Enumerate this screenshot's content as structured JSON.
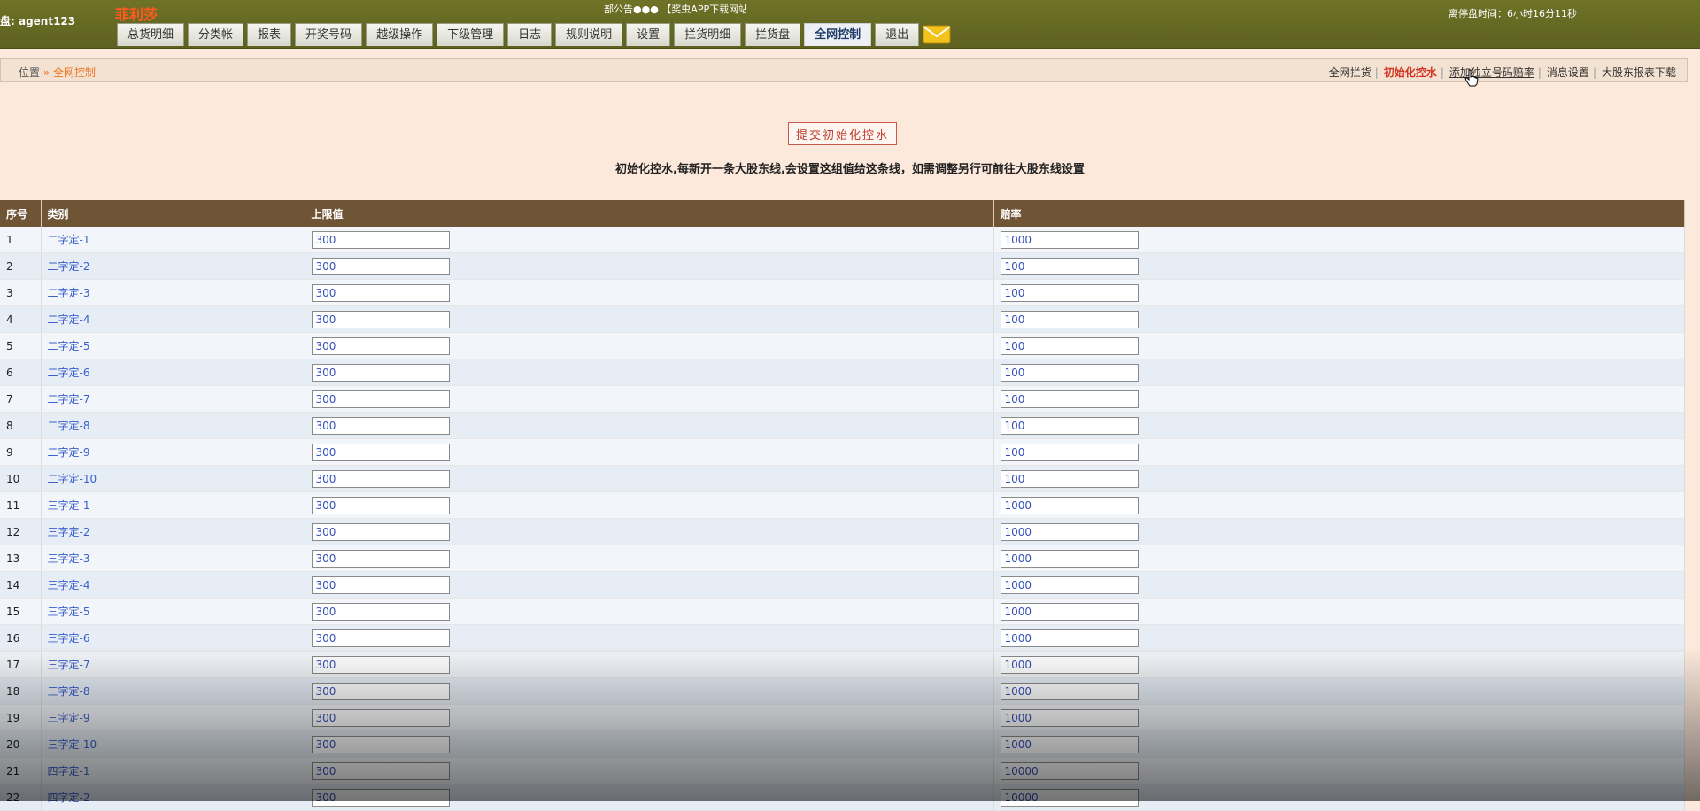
{
  "header": {
    "user_label": "盘: agent123",
    "brand": "菲利莎",
    "notice": "部公告●●● 【奖虫APP下载网站",
    "close_time": "离停盘时间：6小时16分11秒"
  },
  "nav": [
    {
      "label": "总货明细",
      "active": false
    },
    {
      "label": "分类帐",
      "active": false
    },
    {
      "label": "报表",
      "active": false
    },
    {
      "label": "开奖号码",
      "active": false
    },
    {
      "label": "越级操作",
      "active": false
    },
    {
      "label": "下级管理",
      "active": false
    },
    {
      "label": "日志",
      "active": false
    },
    {
      "label": "规则说明",
      "active": false
    },
    {
      "label": "设置",
      "active": false
    },
    {
      "label": "拦货明细",
      "active": false
    },
    {
      "label": "拦货盘",
      "active": false
    },
    {
      "label": "全网控制",
      "active": true
    },
    {
      "label": "退出",
      "active": false
    }
  ],
  "breadcrumb": {
    "prefix": "位置",
    "separator": "»",
    "current": "全网控制"
  },
  "subnav": [
    {
      "label": "全网拦货",
      "style": "normal"
    },
    {
      "label": "初始化控水",
      "style": "active"
    },
    {
      "label": "添加独立号码赔率",
      "style": "underline"
    },
    {
      "label": "消息设置",
      "style": "normal"
    },
    {
      "label": "大股东报表下载",
      "style": "normal"
    }
  ],
  "submit_label": "提交初始化控水",
  "instruction": "初始化控水,每新开一条大股东线,会设置这组值给这条线，如需调整另行可前往大股东线设置",
  "table": {
    "headers": [
      "序号",
      "类别",
      "上限值",
      "赔率"
    ],
    "rows": [
      {
        "no": "1",
        "category": "二字定-1",
        "limit": "300",
        "odds": "1000"
      },
      {
        "no": "2",
        "category": "二字定-2",
        "limit": "300",
        "odds": "100"
      },
      {
        "no": "3",
        "category": "二字定-3",
        "limit": "300",
        "odds": "100"
      },
      {
        "no": "4",
        "category": "二字定-4",
        "limit": "300",
        "odds": "100"
      },
      {
        "no": "5",
        "category": "二字定-5",
        "limit": "300",
        "odds": "100"
      },
      {
        "no": "6",
        "category": "二字定-6",
        "limit": "300",
        "odds": "100"
      },
      {
        "no": "7",
        "category": "二字定-7",
        "limit": "300",
        "odds": "100"
      },
      {
        "no": "8",
        "category": "二字定-8",
        "limit": "300",
        "odds": "100"
      },
      {
        "no": "9",
        "category": "二字定-9",
        "limit": "300",
        "odds": "100"
      },
      {
        "no": "10",
        "category": "二字定-10",
        "limit": "300",
        "odds": "100"
      },
      {
        "no": "11",
        "category": "三字定-1",
        "limit": "300",
        "odds": "1000"
      },
      {
        "no": "12",
        "category": "三字定-2",
        "limit": "300",
        "odds": "1000"
      },
      {
        "no": "13",
        "category": "三字定-3",
        "limit": "300",
        "odds": "1000"
      },
      {
        "no": "14",
        "category": "三字定-4",
        "limit": "300",
        "odds": "1000"
      },
      {
        "no": "15",
        "category": "三字定-5",
        "limit": "300",
        "odds": "1000"
      },
      {
        "no": "16",
        "category": "三字定-6",
        "limit": "300",
        "odds": "1000"
      },
      {
        "no": "17",
        "category": "三字定-7",
        "limit": "300",
        "odds": "1000"
      },
      {
        "no": "18",
        "category": "三字定-8",
        "limit": "300",
        "odds": "1000"
      },
      {
        "no": "19",
        "category": "三字定-9",
        "limit": "300",
        "odds": "1000"
      },
      {
        "no": "20",
        "category": "三字定-10",
        "limit": "300",
        "odds": "1000"
      },
      {
        "no": "21",
        "category": "四字定-1",
        "limit": "300",
        "odds": "10000"
      },
      {
        "no": "22",
        "category": "四字定-2",
        "limit": "300",
        "odds": "10000"
      }
    ]
  },
  "colors": {
    "topbar": "#6f7226",
    "brand": "#ff5a1f",
    "table_header": "#6f5435",
    "category_link": "#3a5fcd",
    "active_subnav": "#d2321f"
  }
}
